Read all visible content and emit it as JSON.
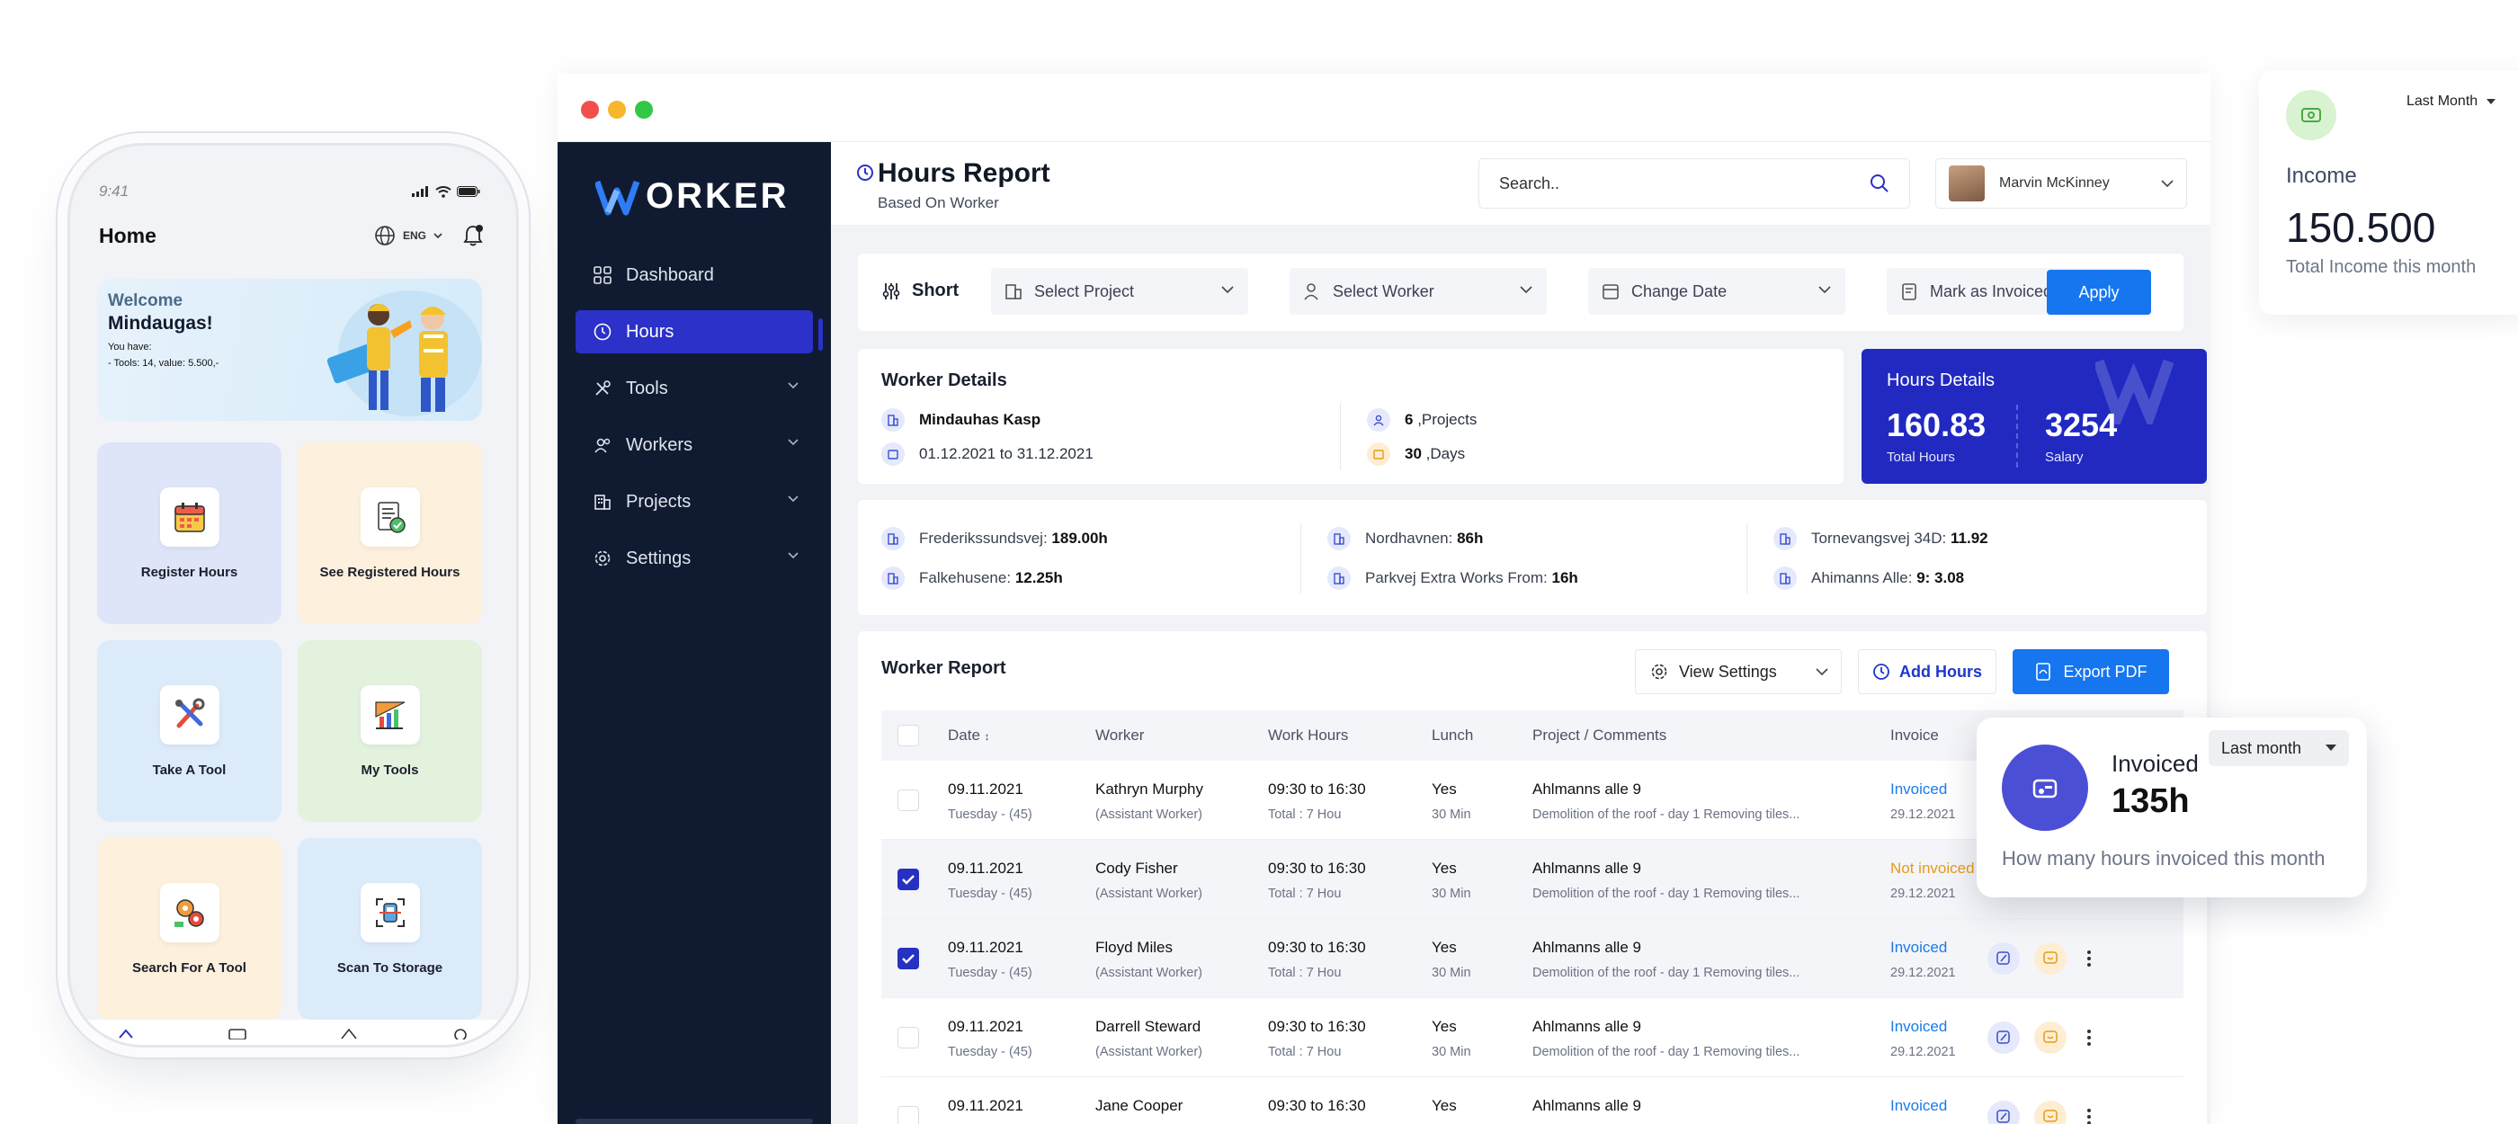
{
  "phone": {
    "time": "9:41",
    "title": "Home",
    "lang": "ENG",
    "welcome_line1": "Welcome",
    "welcome_name": "Mindaugas!",
    "welcome_have": "You have:",
    "welcome_tools": "- Tools: 14, value: 5.500,-",
    "tiles": [
      {
        "label": "Register Hours",
        "icon": "calendar-icon"
      },
      {
        "label": "See Registered Hours",
        "icon": "document-check-icon"
      },
      {
        "label": "Take A Tool",
        "icon": "tools-icon"
      },
      {
        "label": "My Tools",
        "icon": "ruler-chart-icon"
      },
      {
        "label": "Search For A Tool",
        "icon": "gears-icon"
      },
      {
        "label": "Scan To Storage",
        "icon": "scan-icon"
      }
    ]
  },
  "sidebar": {
    "logo": "ORKER",
    "items": [
      {
        "label": "Dashboard"
      },
      {
        "label": "Hours"
      },
      {
        "label": "Tools"
      },
      {
        "label": "Workers"
      },
      {
        "label": "Projects"
      },
      {
        "label": "Settings"
      }
    ]
  },
  "header": {
    "title": "Hours Report",
    "subtitle": "Based On Worker",
    "search_placeholder": "Search..",
    "user_name": "Marvin McKinney"
  },
  "filters": {
    "short_label": "Short",
    "project": "Select Project",
    "worker": "Select Worker",
    "date": "Change Date",
    "invoiced": "Mark as Invoiced",
    "apply": "Apply"
  },
  "worker_details": {
    "title": "Worker Details",
    "name": "Mindauhas Kasp",
    "period": "01.12.2021 to 31.12.2021",
    "projects_count": "6",
    "projects_label": ",Projects",
    "days_count": "30",
    "days_label": ",Days"
  },
  "hours_details": {
    "title": "Hours Details",
    "total_hours": "160.83",
    "total_label": "Total Hours",
    "salary": "3254",
    "salary_label": "Salary"
  },
  "project_hours": [
    {
      "name": "Frederikssundsvej:",
      "value": "189.00h"
    },
    {
      "name": "Falkehusene:",
      "value": "12.25h"
    },
    {
      "name": "Nordhavnen:",
      "value": "86h"
    },
    {
      "name": "Parkvej Extra Works From:",
      "value": "16h"
    },
    {
      "name": "Tornevangsvej 34D:",
      "value": "11.92"
    },
    {
      "name": "Ahimanns Alle:",
      "value": "9: 3.08"
    }
  ],
  "report": {
    "title": "Worker Report",
    "view_settings": "View Settings",
    "add_hours": "Add Hours",
    "export_pdf": "Export PDF",
    "columns": [
      "Date",
      "Worker",
      "Work Hours",
      "Lunch",
      "Project / Comments",
      "Invoice"
    ],
    "rows": [
      {
        "date": "09.11.2021",
        "day": "Tuesday - (45)",
        "worker": "Kathryn Murphy",
        "role": "(Assistant Worker)",
        "hours": "09:30 to 16:30",
        "total": "Total : 7 Hou",
        "lunch": "Yes",
        "lunch_min": "30 Min",
        "project": "Ahlmanns alle 9",
        "comment": "Demolition of the roof - day 1 Removing tiles...",
        "status": "Invoiced",
        "inv_date": "29.12.2021",
        "checked": false
      },
      {
        "date": "09.11.2021",
        "day": "Tuesday - (45)",
        "worker": "Cody Fisher",
        "role": "(Assistant Worker)",
        "hours": "09:30 to 16:30",
        "total": "Total : 7 Hou",
        "lunch": "Yes",
        "lunch_min": "30 Min",
        "project": "Ahlmanns alle 9",
        "comment": "Demolition of the roof - day 1 Removing tiles...",
        "status": "Not invoiced",
        "inv_date": "29.12.2021",
        "checked": true
      },
      {
        "date": "09.11.2021",
        "day": "Tuesday - (45)",
        "worker": "Floyd Miles",
        "role": "(Assistant Worker)",
        "hours": "09:30 to 16:30",
        "total": "Total : 7 Hou",
        "lunch": "Yes",
        "lunch_min": "30 Min",
        "project": "Ahlmanns alle 9",
        "comment": "Demolition of the roof - day 1 Removing tiles...",
        "status": "Invoiced",
        "inv_date": "29.12.2021",
        "checked": true
      },
      {
        "date": "09.11.2021",
        "day": "Tuesday - (45)",
        "worker": "Darrell Steward",
        "role": "(Assistant Worker)",
        "hours": "09:30 to 16:30",
        "total": "Total : 7 Hou",
        "lunch": "Yes",
        "lunch_min": "30 Min",
        "project": "Ahlmanns alle 9",
        "comment": "Demolition of the roof - day 1 Removing tiles...",
        "status": "Invoiced",
        "inv_date": "29.12.2021",
        "checked": false
      },
      {
        "date": "09.11.2021",
        "day": "",
        "worker": "Jane Cooper",
        "role": "",
        "hours": "09:30 to 16:30",
        "total": "",
        "lunch": "Yes",
        "lunch_min": "",
        "project": "Ahlmanns alle 9",
        "comment": "",
        "status": "Invoiced",
        "inv_date": "",
        "checked": false
      }
    ]
  },
  "income_card": {
    "range": "Last Month",
    "label": "Income",
    "value": "150.500",
    "sub": "Total Income this month"
  },
  "invoiced_card": {
    "label": "Invoiced",
    "value": "135h",
    "range": "Last month",
    "sub": "How many hours invoiced this month"
  },
  "colors": {
    "sidebar_bg": "#101b31",
    "accent_blue": "#2b31c9",
    "button_blue": "#1576f0",
    "invoiced": "#1a7be8",
    "not_invoiced": "#e69a18"
  }
}
